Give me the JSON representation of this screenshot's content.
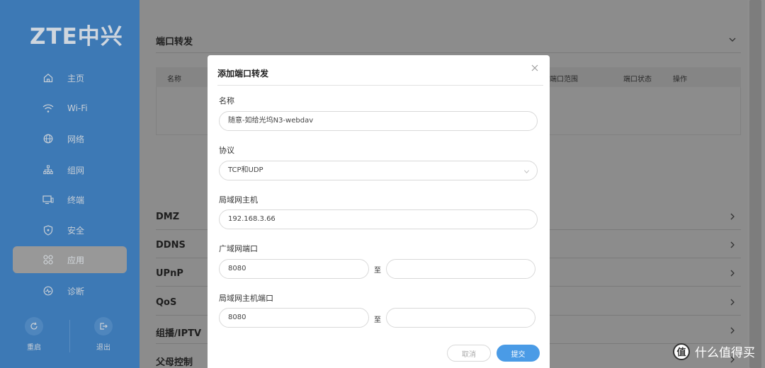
{
  "brand": {
    "logo": "ZTE中兴"
  },
  "sidebar": {
    "items": [
      {
        "label": "主页",
        "icon": "home-icon"
      },
      {
        "label": "Wi-Fi",
        "icon": "wifi-icon"
      },
      {
        "label": "网络",
        "icon": "globe-icon"
      },
      {
        "label": "组网",
        "icon": "mesh-icon"
      },
      {
        "label": "终端",
        "icon": "devices-icon"
      },
      {
        "label": "安全",
        "icon": "shield-icon"
      },
      {
        "label": "应用",
        "icon": "apps-icon",
        "active": true
      },
      {
        "label": "诊断",
        "icon": "diagnose-icon"
      }
    ],
    "restart_label": "重启",
    "logout_label": "退出"
  },
  "main": {
    "port_forward_title": "端口转发",
    "table_headers": {
      "name": "名称",
      "port_range": "端口范围",
      "port_status": "端口状态",
      "action": "操作"
    },
    "sections": [
      "DMZ",
      "DDNS",
      "UPnP",
      "QoS",
      "组播/IPTV",
      "父母控制"
    ]
  },
  "dialog": {
    "title": "添加端口转发",
    "name_label": "名称",
    "name_value": "随意-如给光坞N3-webdav",
    "protocol_label": "协议",
    "protocol_value": "TCP和UDP",
    "lan_host_label": "局域网主机",
    "lan_host_value": "192.168.3.66",
    "wan_port_label": "广域网端口",
    "wan_port_start": "8080",
    "wan_port_end": "",
    "lan_port_label": "局域网主机端口",
    "lan_port_start": "8080",
    "lan_port_end": "",
    "to_label": "至",
    "cancel_label": "取消",
    "submit_label": "提交"
  },
  "watermark": {
    "text": "什么值得买",
    "badge": "值"
  },
  "colors": {
    "sidebar": "#3d79b5",
    "accent": "#4a9be6",
    "overlay": "#8c8c8c"
  }
}
